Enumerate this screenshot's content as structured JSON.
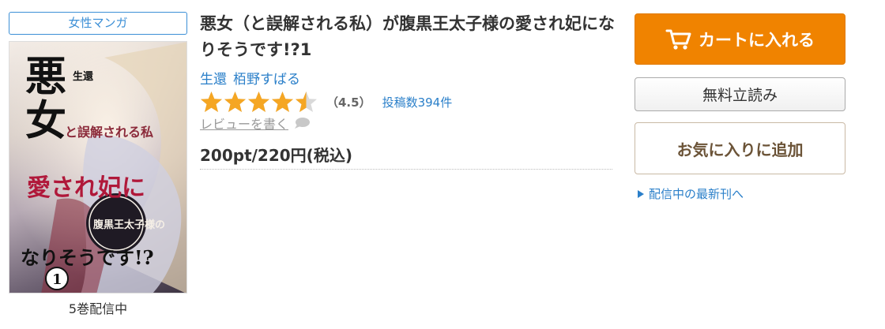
{
  "genre": "女性マンガ",
  "cover": {
    "title_chars": [
      "悪",
      "女"
    ],
    "subtitle": "と誤解される私",
    "author_mark": "生還",
    "prince_text": "腹黒王太子様の",
    "love_text": "愛され妃に",
    "ending_text": "なりそうです!?",
    "volume": "1"
  },
  "volumes_text": "5巻配信中",
  "book": {
    "title": "悪女（と誤解される私）が腹黒王太子様の愛され妃になりそうです!?1",
    "authors": [
      "生還",
      "栢野すばる"
    ],
    "rating_value": 4.5,
    "score_text": "（4.5）",
    "reviews_text": "投稿数394件",
    "write_review": "レビューを書く",
    "price": "200pt/220円(税込)"
  },
  "buttons": {
    "cart": "カートに入れる",
    "read": "無料立読み",
    "favorite": "お気に入りに追加"
  },
  "latest_link": "配信中の最新刊へ",
  "colors": {
    "accent_blue": "#2a7fc9",
    "cart_orange": "#f08300",
    "star_gold": "#f5a623",
    "favorite_brown": "#6b5337"
  },
  "icons": {
    "cart": "shopping-cart-icon",
    "review": "speech-bubble-icon",
    "link_arrow": "triangle-right-icon"
  }
}
